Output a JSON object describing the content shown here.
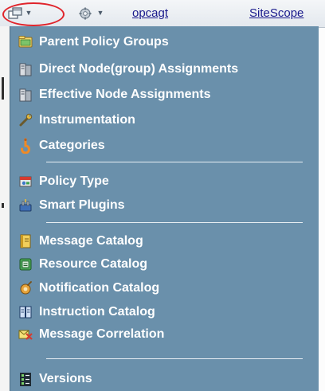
{
  "toolbar": {
    "link_1": "opcagt",
    "link_2": "SiteScope",
    "icons": [
      "window-menu-icon",
      "settings-icon"
    ]
  },
  "menu": {
    "items": [
      {
        "label": "Parent Policy Groups",
        "icon": "folder-group-icon"
      },
      {
        "label": "Direct Node(group) Assignments",
        "icon": "server-assignment-icon"
      },
      {
        "label": "Effective Node Assignments",
        "icon": "server-assignment-icon"
      },
      {
        "label": "Instrumentation",
        "icon": "wrench-icon"
      },
      {
        "label": "Categories",
        "icon": "hook-icon"
      },
      {
        "label": "Policy Type",
        "icon": "policy-type-icon"
      },
      {
        "label": "Smart Plugins",
        "icon": "plugin-icon"
      },
      {
        "label": "Message Catalog",
        "icon": "catalog-book-icon"
      },
      {
        "label": "Resource Catalog",
        "icon": "resource-catalog-icon"
      },
      {
        "label": "Notification Catalog",
        "icon": "notification-icon"
      },
      {
        "label": "Instruction Catalog",
        "icon": "instruction-book-icon"
      },
      {
        "label": "Message Correlation",
        "icon": "correlation-icon"
      },
      {
        "label": "Versions",
        "icon": "versions-list-icon"
      }
    ]
  },
  "colors": {
    "menu_background": "#6a90ab",
    "menu_text": "#ffffff",
    "highlight_ring": "#e0242b",
    "link": "#1a1a8c"
  }
}
